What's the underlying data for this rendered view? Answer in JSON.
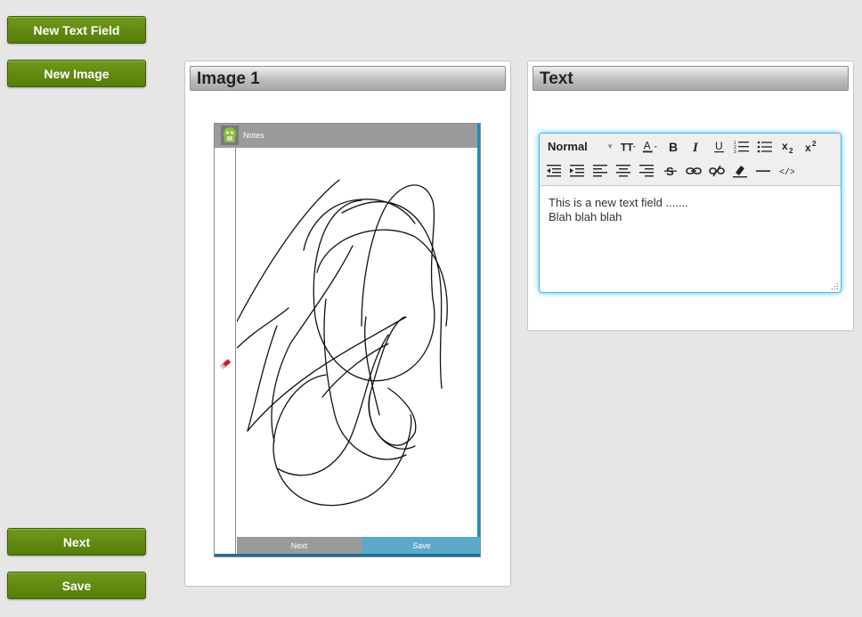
{
  "sidebar": {
    "new_text_field": "New Text Field",
    "new_image": "New Image",
    "next": "Next",
    "save": "Save"
  },
  "image_panel": {
    "title": "Image 1",
    "phone": {
      "app_title": "Notes",
      "next_label": "Next",
      "save_label": "Save"
    }
  },
  "text_panel": {
    "title": "Text",
    "toolbar": {
      "format_value": "Normal",
      "row1": [
        "font-size-icon",
        "text-color-icon",
        "bold-icon",
        "italic-icon",
        "underline-icon",
        "ordered-list-icon",
        "unordered-list-icon",
        "subscript-icon",
        "superscript-icon"
      ],
      "row2": [
        "outdent-icon",
        "indent-icon",
        "align-left-icon",
        "align-center-icon",
        "align-right-icon",
        "strikethrough-icon",
        "link-icon",
        "unlink-icon",
        "clear-format-icon",
        "horizontal-rule-icon",
        "code-view-icon"
      ]
    },
    "content_lines": [
      "This is a new text field .......",
      "Blah blah blah"
    ]
  },
  "colors": {
    "button_green": "#6f9a1a",
    "editor_glow": "#56c8f5",
    "phone_save_blue": "#5da9c9"
  }
}
